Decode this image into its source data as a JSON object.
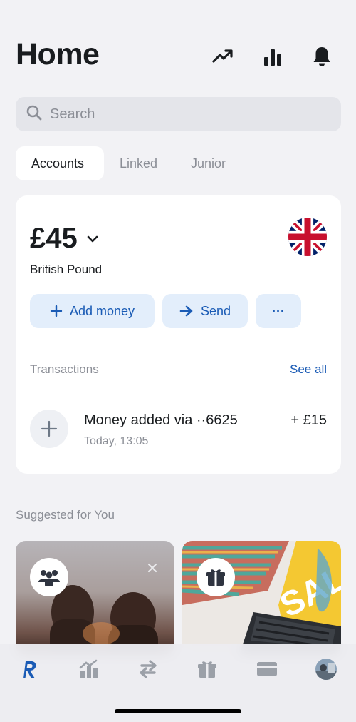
{
  "header": {
    "title": "Home",
    "icons": [
      "trending-up-icon",
      "bar-chart-icon",
      "bell-icon"
    ]
  },
  "search": {
    "placeholder": "Search"
  },
  "tabs": [
    {
      "label": "Accounts",
      "active": true
    },
    {
      "label": "Linked",
      "active": false
    },
    {
      "label": "Junior",
      "active": false
    }
  ],
  "account": {
    "balance": "£45",
    "currency": "British Pound",
    "flag": "uk-flag-icon",
    "actions": {
      "add_money": "Add money",
      "send": "Send",
      "more": "···"
    },
    "transactions_label": "Transactions",
    "see_all": "See all",
    "transactions": [
      {
        "title": "Money added via ··6625",
        "time": "Today, 13:05",
        "amount": "+ £15"
      }
    ]
  },
  "suggested": {
    "label": "Suggested for You",
    "cards": [
      {
        "icon": "group-icon",
        "dismissible": true
      },
      {
        "icon": "gift-icon",
        "dismissible": false,
        "image_text": "SAL"
      }
    ]
  },
  "bottom_nav": [
    "revolut-logo-icon",
    "wealth-icon",
    "transfer-icon",
    "rewards-icon",
    "cards-icon",
    "profile-avatar"
  ],
  "colors": {
    "accent": "#1a5bb5",
    "accent_bg": "#e3eefb",
    "background": "#f2f2f5"
  }
}
